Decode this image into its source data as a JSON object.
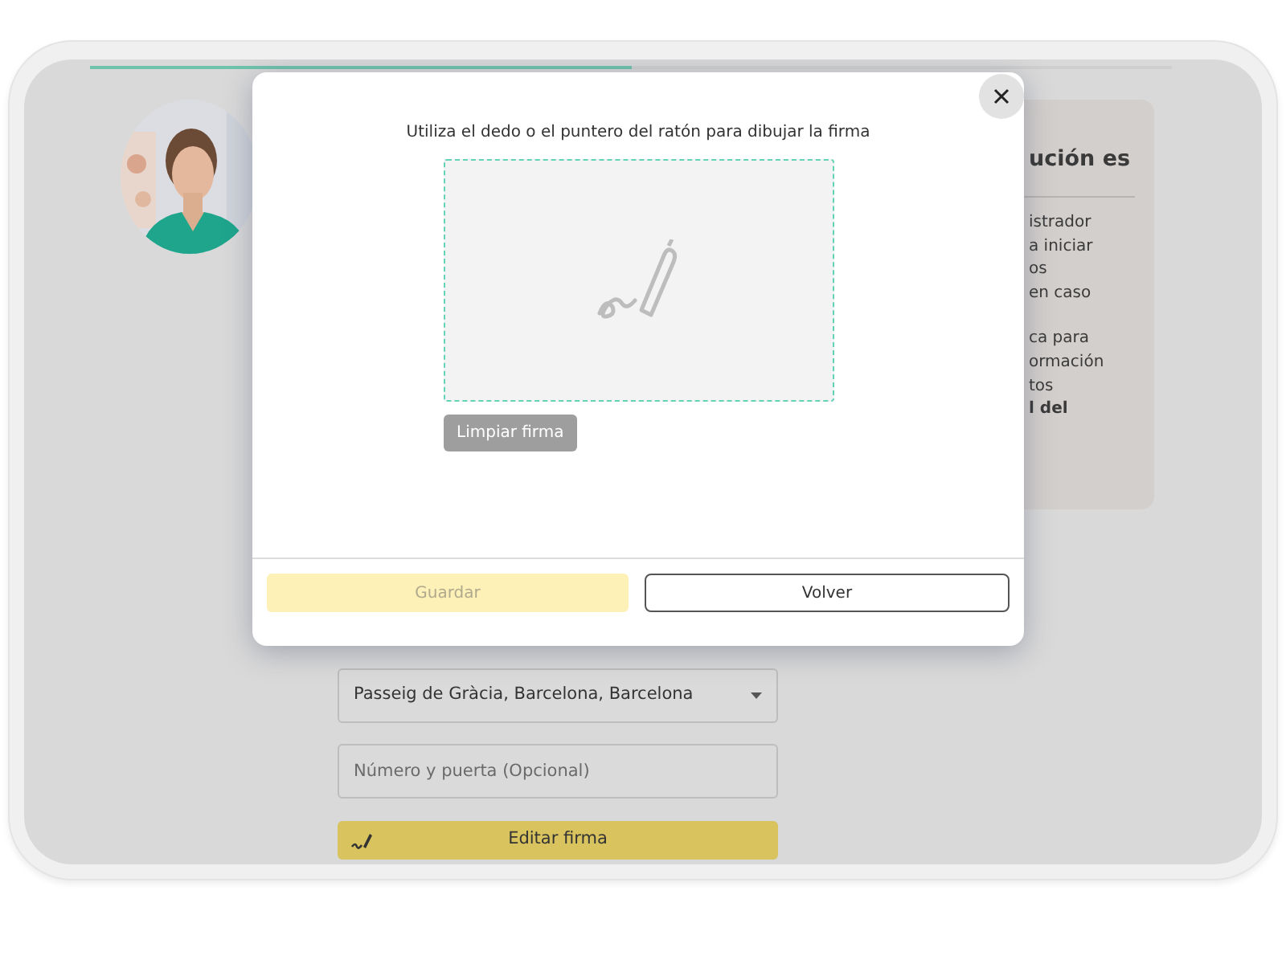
{
  "progress": {
    "level": 0.5
  },
  "info_card": {
    "title": "ución es",
    "paragraphs": [
      [
        {
          "text": "istrador",
          "bold": false
        },
        {
          "text": "a iniciar",
          "bold": false
        },
        {
          "text": "os",
          "bold": false
        },
        {
          "text": "en caso",
          "bold": false
        }
      ],
      [
        {
          "text": "ca para",
          "bold": false
        },
        {
          "text": "ormación",
          "bold": false
        },
        {
          "text": "tos",
          "bold": false
        },
        {
          "text": "l del",
          "bold": true
        }
      ]
    ]
  },
  "address_form": {
    "street_select": {
      "value": "Passeig de Gràcia, Barcelona, Barcelona"
    },
    "door_field": {
      "placeholder": "Número y puerta (Opcional)"
    },
    "edit_signature_button": "Editar firma"
  },
  "modal": {
    "instruction": "Utiliza el dedo o el puntero del ratón para dibujar la firma",
    "clear_button": "Limpiar firma",
    "save_button": {
      "label": "Guardar",
      "disabled": true
    },
    "back_button": "Volver"
  }
}
